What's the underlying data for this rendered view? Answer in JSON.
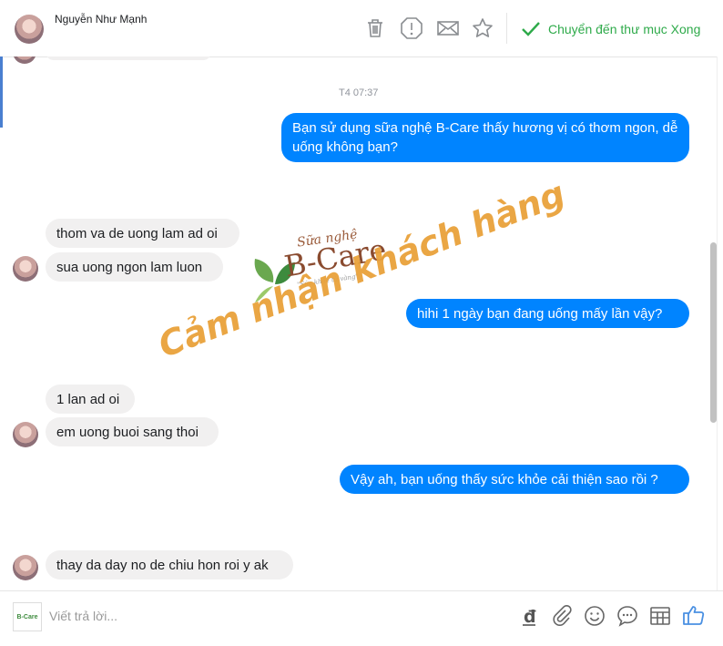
{
  "header": {
    "contact_name": "Nguyễn Như Mạnh",
    "icons": [
      "trash-icon",
      "report-icon",
      "envelope-icon",
      "star-icon"
    ],
    "done_label": "Chuyển đến thư mục Xong",
    "done_color": "#2eaa4a"
  },
  "chat": {
    "timestamp": "T4 07:37",
    "messages": [
      {
        "from": "page",
        "text": "Bạn sử dụng sữa nghệ B-Care thấy hương vị có thơm ngon, dễ uống không bạn?"
      },
      {
        "from": "customer",
        "text": "thom va de uong lam ad oi"
      },
      {
        "from": "customer",
        "text": "sua uong ngon lam luon"
      },
      {
        "from": "page",
        "text": "hihi 1 ngày bạn đang uống mấy lần vậy?"
      },
      {
        "from": "customer",
        "text": "1 lan ad oi"
      },
      {
        "from": "customer",
        "text": "em uong buoi sang thoi"
      },
      {
        "from": "page",
        "text": "Vậy ah, bạn uống thấy sức khỏe cải thiện sao rồi ?"
      },
      {
        "from": "customer",
        "text": "thay da day no de chiu hon roi y ak"
      }
    ],
    "outgoing_color": "#0084ff",
    "incoming_color": "#f1f0f0"
  },
  "watermark": {
    "caption": "Cảm nhận khách hàng",
    "logo_line1": "Sữa nghệ",
    "logo_brand": "B-Care",
    "logo_tagline": "\"Sức khỏe từ vàng\"",
    "color": "#e9a23b"
  },
  "composer": {
    "placeholder": "Viết trả lời...",
    "avatar_text": "B-Care",
    "icons": [
      "dong-currency-icon",
      "paperclip-icon",
      "emoji-icon",
      "saved-replies-icon",
      "template-icon",
      "like-icon"
    ],
    "like_color": "#4a90e2"
  }
}
